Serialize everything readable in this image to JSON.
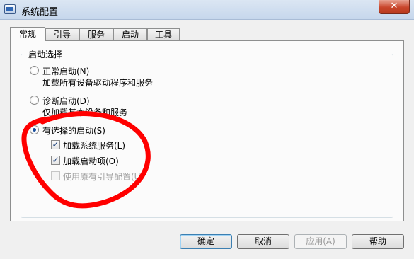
{
  "window": {
    "title": "系统配置",
    "close_label": "✕"
  },
  "tabs": [
    {
      "label": "常规",
      "active": true
    },
    {
      "label": "引导",
      "active": false
    },
    {
      "label": "服务",
      "active": false
    },
    {
      "label": "启动",
      "active": false
    },
    {
      "label": "工具",
      "active": false
    }
  ],
  "startup_group": {
    "label": "启动选择",
    "options": [
      {
        "label": "正常启动(N)",
        "description": "加载所有设备驱动程序和服务",
        "selected": false
      },
      {
        "label": "诊断启动(D)",
        "description": "仅加载基本设备和服务",
        "selected": false
      },
      {
        "label": "有选择的启动(S)",
        "selected": true
      }
    ],
    "selective": [
      {
        "label": "加载系统服务(L)",
        "checked": true,
        "enabled": true
      },
      {
        "label": "加载启动项(O)",
        "checked": true,
        "enabled": true
      },
      {
        "label": "使用原有引导配置(U)",
        "checked": false,
        "enabled": false
      }
    ]
  },
  "buttons": {
    "ok": "确定",
    "cancel": "取消",
    "apply": "应用(A)",
    "help": "帮助"
  },
  "colors": {
    "annotation": "#ff0000",
    "title_gradient": "#c6d7ec",
    "close_button": "#c9462c"
  }
}
